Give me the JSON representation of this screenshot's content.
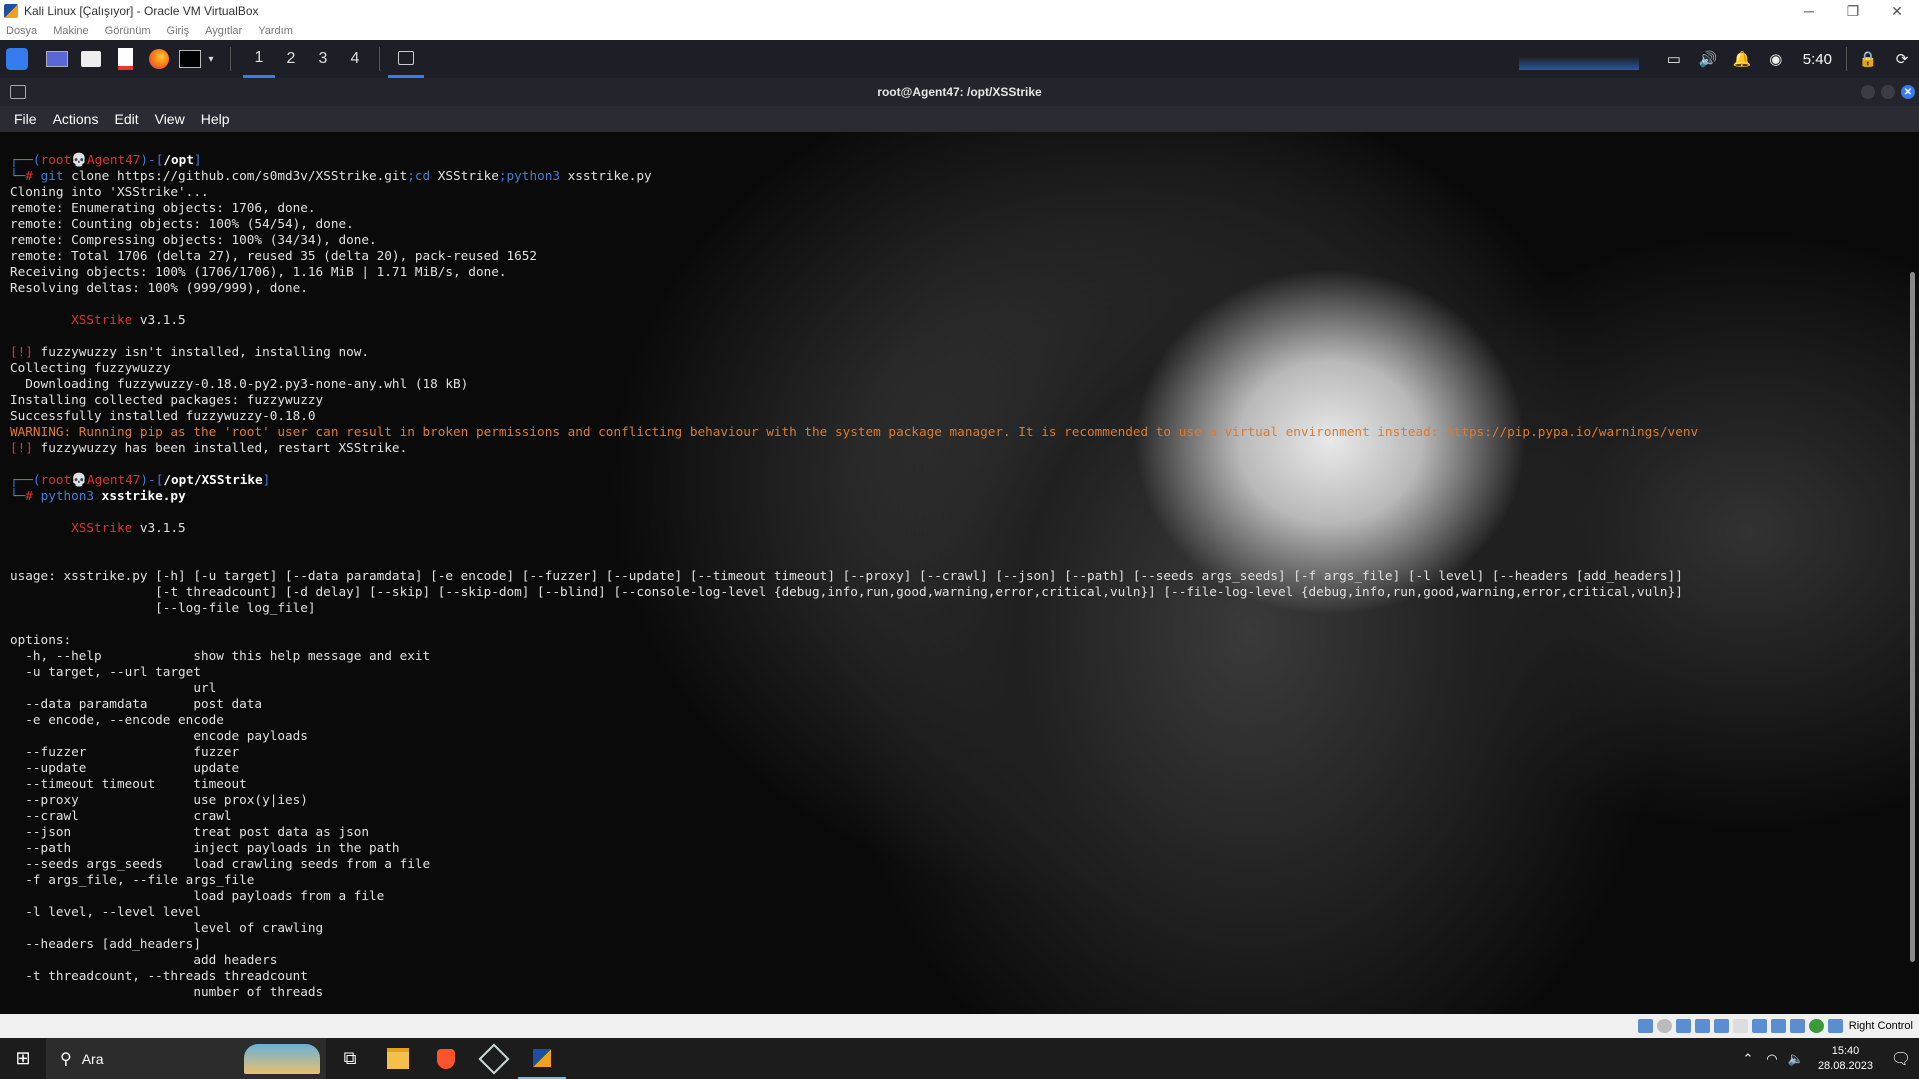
{
  "host_window": {
    "title": "Kali Linux [Çalışıyor] - Oracle VM VirtualBox",
    "controls": {
      "minimize": "─",
      "restore": "❐",
      "close": "✕"
    }
  },
  "host_menu": [
    "Dosya",
    "Makine",
    "Görünüm",
    "Giriş",
    "Aygıtlar",
    "Yardım"
  ],
  "kali_panel": {
    "workspaces": [
      "1",
      "2",
      "3",
      "4"
    ],
    "clock": "5:40"
  },
  "terminal": {
    "title": "root@Agent47: /opt/XSStrike",
    "menu": [
      "File",
      "Actions",
      "Edit",
      "View",
      "Help"
    ],
    "prompt1": {
      "user": "root",
      "skull": "💀",
      "host": "Agent47",
      "path": "/opt",
      "cmd_git": "git",
      "cmd_rest": " clone https://github.com/s0md3v/XSStrike.git",
      "sep1": ";cd",
      "cd_arg": " XSStrike",
      "sep2": ";python3",
      "py_arg": " xsstrike.py"
    },
    "clone_output": "Cloning into 'XSStrike'...\nremote: Enumerating objects: 1706, done.\nremote: Counting objects: 100% (54/54), done.\nremote: Compressing objects: 100% (34/34), done.\nremote: Total 1706 (delta 27), reused 35 (delta 20), pack-reused 1652\nReceiving objects: 100% (1706/1706), 1.16 MiB | 1.71 MiB/s, done.\nResolving deltas: 100% (999/999), done.",
    "banner_name": "XSStrike",
    "banner_version": " v3.1.5",
    "warn_tag": "[!]",
    "warn1": " fuzzywuzzy isn't installed, installing now.",
    "install_output": "Collecting fuzzywuzzy\n  Downloading fuzzywuzzy-0.18.0-py2.py3-none-any.whl (18 kB)\nInstalling collected packages: fuzzywuzzy\nSuccessfully installed fuzzywuzzy-0.18.0",
    "pip_warning": "WARNING: Running pip as the 'root' user can result in broken permissions and conflicting behaviour with the system package manager. It is recommended to use a virtual environment instead: https://pip.pypa.io/warnings/venv",
    "warn2": " fuzzywuzzy has been installed, restart XSStrike.",
    "prompt2": {
      "user": "root",
      "skull": "💀",
      "host": "Agent47",
      "path": "/opt/XSStrike",
      "cmd": "python3",
      "arg": " xsstrike.py"
    },
    "usage": "usage: xsstrike.py [-h] [-u target] [--data paramdata] [-e encode] [--fuzzer] [--update] [--timeout timeout] [--proxy] [--crawl] [--json] [--path] [--seeds args_seeds] [-f args_file] [-l level] [--headers [add_headers]]\n                   [-t threadcount] [-d delay] [--skip] [--skip-dom] [--blind] [--console-log-level {debug,info,run,good,warning,error,critical,vuln}] [--file-log-level {debug,info,run,good,warning,error,critical,vuln}]\n                   [--log-file log_file]",
    "options": "options:\n  -h, --help            show this help message and exit\n  -u target, --url target\n                        url\n  --data paramdata      post data\n  -e encode, --encode encode\n                        encode payloads\n  --fuzzer              fuzzer\n  --update              update\n  --timeout timeout     timeout\n  --proxy               use prox(y|ies)\n  --crawl               crawl\n  --json                treat post data as json\n  --path                inject payloads in the path\n  --seeds args_seeds    load crawling seeds from a file\n  -f args_file, --file args_file\n                        load payloads from a file\n  -l level, --level level\n                        level of crawling\n  --headers [add_headers]\n                        add headers\n  -t threadcount, --threads threadcount\n                        number of threads"
  },
  "vbox_status": {
    "host_key": "Right Control"
  },
  "taskbar": {
    "search_placeholder": "Ara",
    "time": "15:40",
    "date": "28.08.2023"
  },
  "colors": {
    "accent_blue": "#367bf0",
    "prompt_red": "#e03030",
    "warning_orange": "#e07a2a"
  }
}
